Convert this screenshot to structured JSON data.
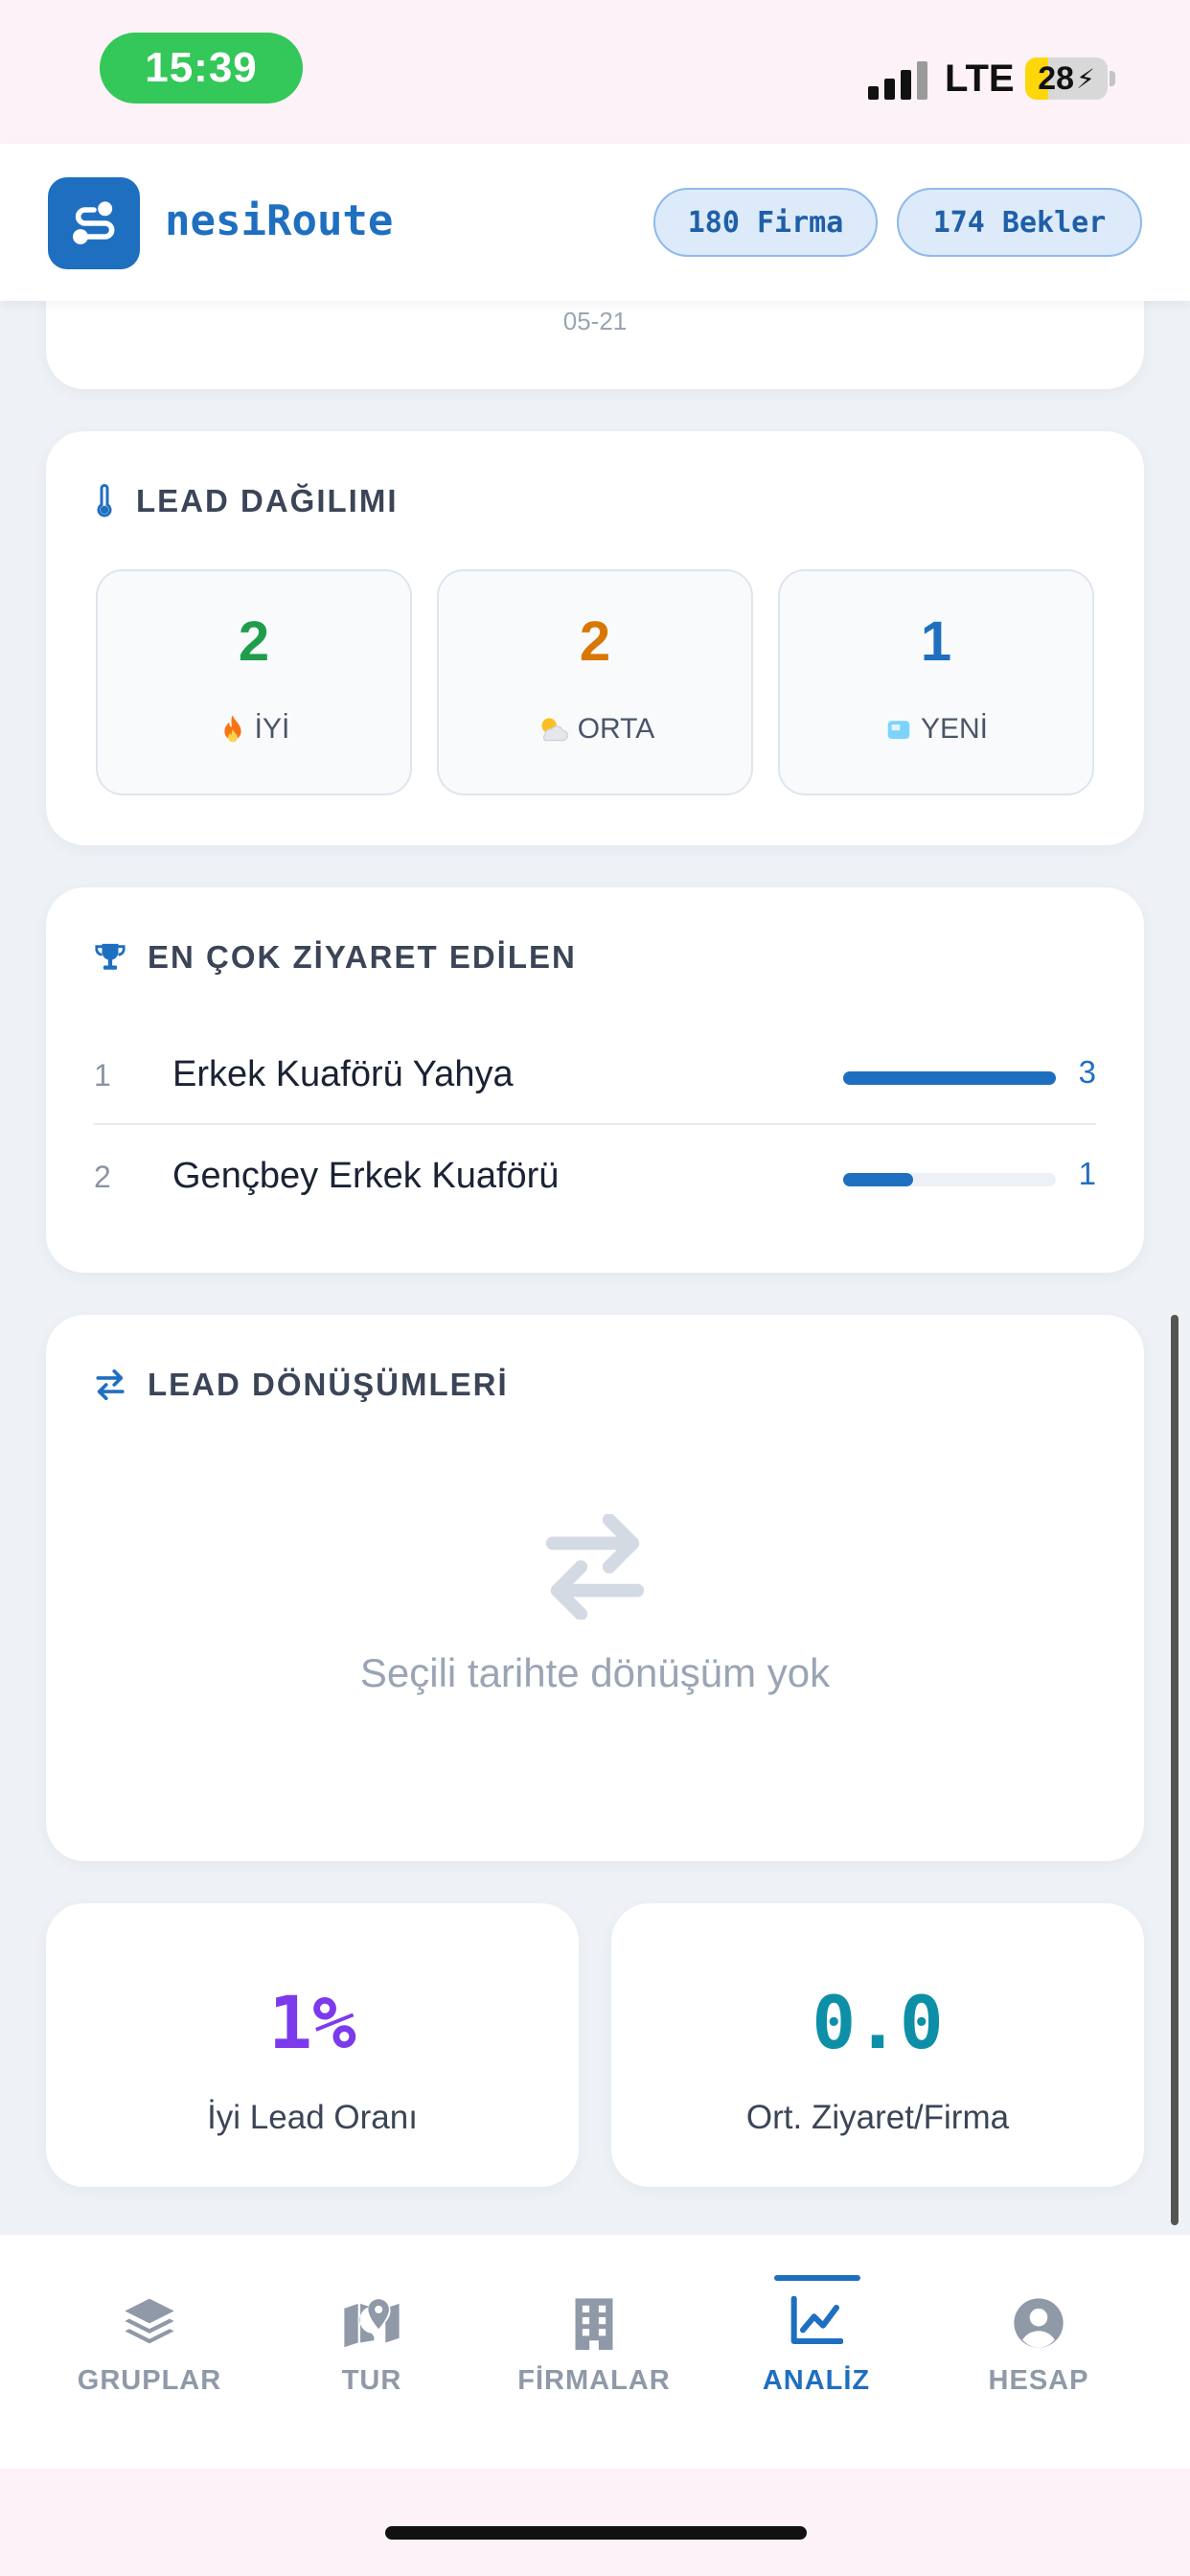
{
  "status_bar": {
    "time": "15:39",
    "network": "LTE",
    "battery": "28",
    "battery_level": 0.28
  },
  "header": {
    "brand": "nesiRoute",
    "chips": [
      "180 Firma",
      "174 Bekler"
    ]
  },
  "previous_card": {
    "date_label": "05-21"
  },
  "lead_distribution": {
    "title": "LEAD DAĞILIMI",
    "items": [
      {
        "value": "2",
        "label": "İYİ",
        "emoji": "fire-emoji",
        "color": "#1f9d4c"
      },
      {
        "value": "2",
        "label": "ORTA",
        "emoji": "sun-cloud-emoji",
        "color": "#d97706"
      },
      {
        "value": "1",
        "label": "YENİ",
        "emoji": "ice-emoji",
        "color": "#1f6fc0"
      }
    ]
  },
  "most_visited": {
    "title": "EN ÇOK ZİYARET EDİLEN",
    "rows": [
      {
        "rank": "1",
        "name": "Erkek Kuaförü Yahya",
        "count": "3",
        "fraction": 1.0
      },
      {
        "rank": "2",
        "name": "Gençbey Erkek Kuaförü",
        "count": "1",
        "fraction": 0.33
      }
    ]
  },
  "conversions": {
    "title": "LEAD DÖNÜŞÜMLERİ",
    "empty_text": "Seçili tarihte dönüşüm yok"
  },
  "stats": [
    {
      "value": "1%",
      "label": "İyi Lead Oranı",
      "color": "#7c3aed"
    },
    {
      "value": "0.0",
      "label": "Ort. Ziyaret/Firma",
      "color": "#0e8fa8"
    }
  ],
  "bottom_nav": {
    "items": [
      {
        "label": "GRUPLAR",
        "icon": "layers-icon",
        "active": false
      },
      {
        "label": "TUR",
        "icon": "map-pin-icon",
        "active": false
      },
      {
        "label": "FİRMALAR",
        "icon": "building-icon",
        "active": false
      },
      {
        "label": "ANALİZ",
        "icon": "chart-line-icon",
        "active": true
      },
      {
        "label": "HESAP",
        "icon": "user-circle-icon",
        "active": false
      }
    ]
  }
}
